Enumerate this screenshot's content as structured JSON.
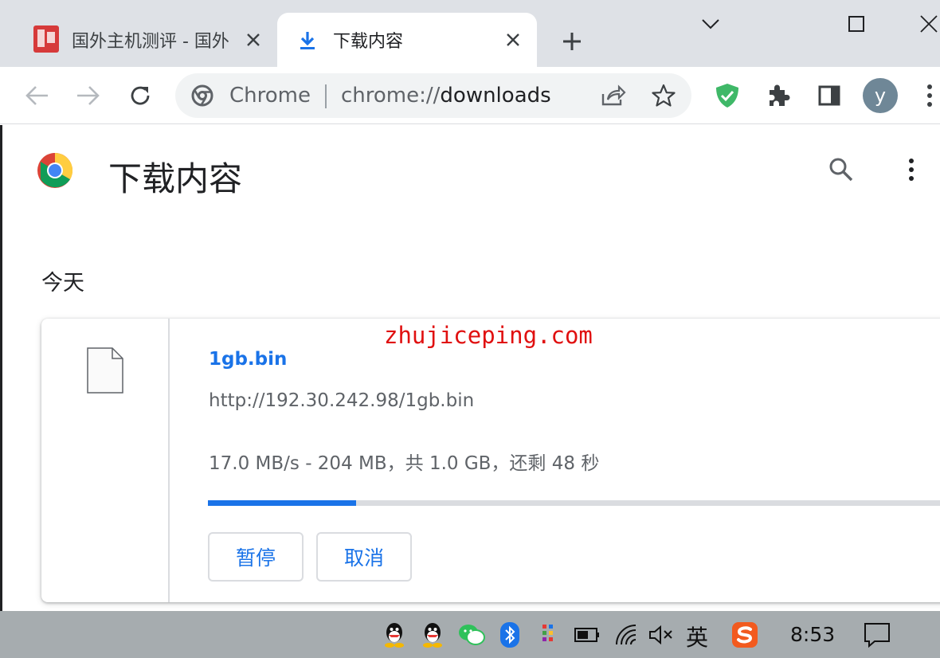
{
  "tabs": [
    {
      "title": "国外主机测评 - 国外",
      "active": false
    },
    {
      "title": "下载内容",
      "active": true
    }
  ],
  "toolbar": {
    "site_chip": "Chrome",
    "url_scheme": "chrome://",
    "url_path": "downloads",
    "profile_initial": "y"
  },
  "page": {
    "title": "下载内容",
    "section_date": "今天"
  },
  "download": {
    "file_name": "1gb.bin",
    "url": "http://192.30.242.98/1gb.bin",
    "status": "17.0 MB/s - 204 MB，共 1.0 GB，还剩 48 秒",
    "progress": 0.2,
    "pause_label": "暂停",
    "cancel_label": "取消"
  },
  "watermark": "zhujiceping.com",
  "taskbar": {
    "ime_label": "英",
    "time": "8:53"
  },
  "colors": {
    "accent": "#1a73e8",
    "tabstrip": "#dee1e6",
    "taskbar": "#a6acaf",
    "watermark": "#e01010"
  }
}
